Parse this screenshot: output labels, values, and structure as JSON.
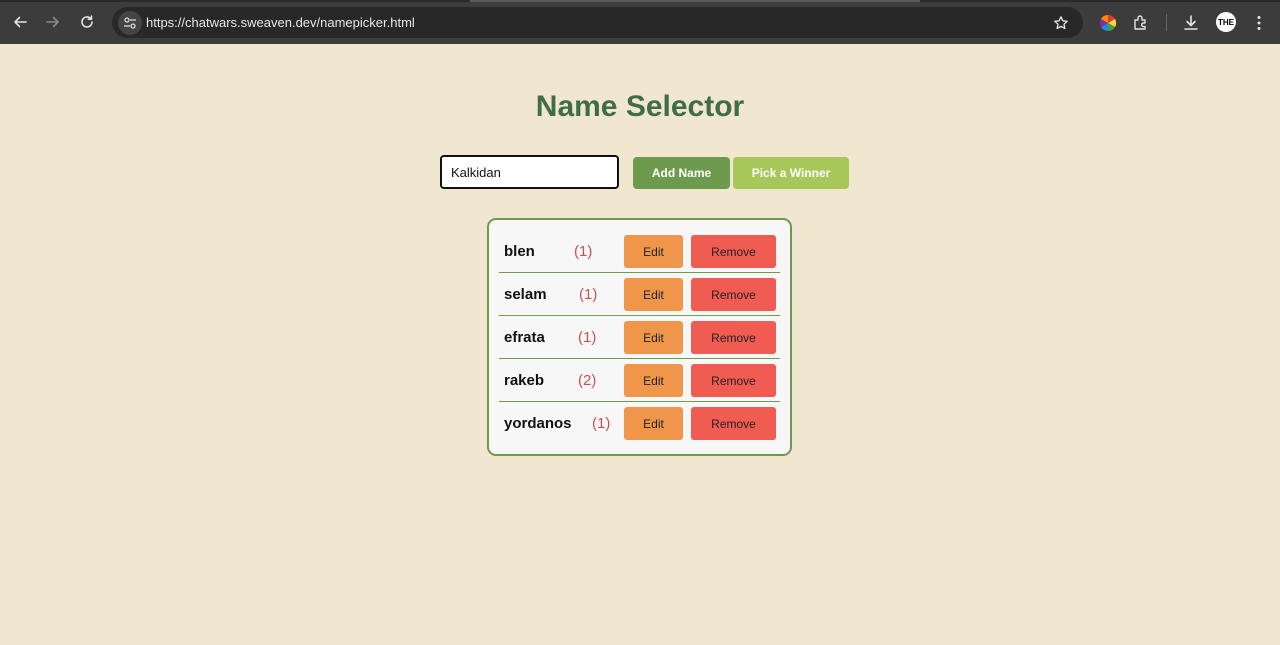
{
  "browser": {
    "url": "https://chatwars.sweaven.dev/namepicker.html",
    "profile_initials": "THE"
  },
  "page": {
    "title": "Name Selector",
    "input": {
      "value": "Kalkidan",
      "placeholder": ""
    },
    "add_button_label": "Add Name",
    "pick_button_label": "Pick a Winner"
  },
  "names": [
    {
      "name": "blen",
      "count": "(1)",
      "edit_label": "Edit",
      "remove_label": "Remove"
    },
    {
      "name": "selam",
      "count": "(1)",
      "edit_label": "Edit",
      "remove_label": "Remove"
    },
    {
      "name": "efrata",
      "count": "(1)",
      "edit_label": "Edit",
      "remove_label": "Remove"
    },
    {
      "name": "rakeb",
      "count": "(2)",
      "edit_label": "Edit",
      "remove_label": "Remove"
    },
    {
      "name": "yordanos",
      "count": "(1)",
      "edit_label": "Edit",
      "remove_label": "Remove"
    }
  ],
  "colors": {
    "page_background": "#f1e6cf",
    "title": "#3f6e42",
    "add_button": "#6d9a4c",
    "pick_button": "#a7c75a",
    "edit_button": "#f0964a",
    "remove_button": "#f05b52",
    "count_text": "#c65353"
  },
  "icons": {
    "back": "arrow-left-icon",
    "forward": "arrow-right-icon",
    "reload": "reload-icon",
    "site_info": "tune-icon",
    "bookmark": "star-icon",
    "extension_color": "color-wheel-icon",
    "extensions": "puzzle-icon",
    "downloads": "download-icon",
    "menu": "kebab-menu-icon"
  }
}
